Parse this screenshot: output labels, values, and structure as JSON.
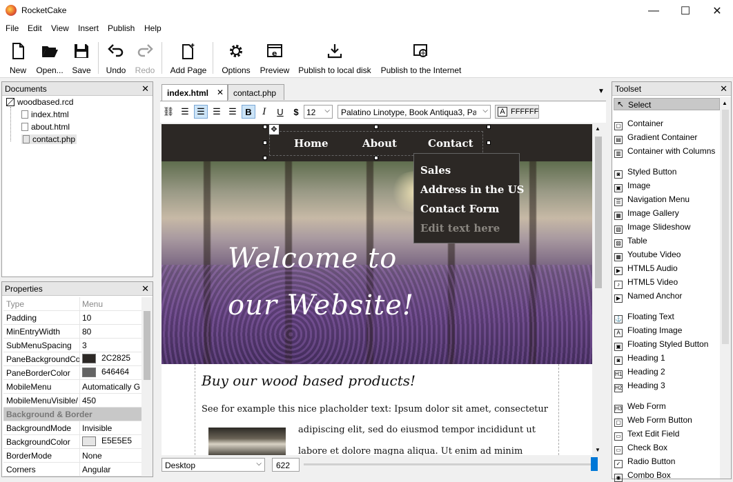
{
  "app": {
    "title": "RocketCake"
  },
  "window_controls": {
    "minimize": "—",
    "maximize": "☐",
    "close": "✕"
  },
  "menu": [
    "File",
    "Edit",
    "View",
    "Insert",
    "Publish",
    "Help"
  ],
  "toolbar": {
    "new": "New",
    "open": "Open...",
    "save": "Save",
    "undo": "Undo",
    "redo": "Redo",
    "add_page": "Add Page",
    "options": "Options",
    "preview": "Preview",
    "publish_local": "Publish to local disk",
    "publish_internet": "Publish to the Internet"
  },
  "documents": {
    "title": "Documents",
    "project": "woodbased.rcd",
    "files": [
      "index.html",
      "about.html",
      "contact.php"
    ],
    "selected": "contact.php"
  },
  "properties": {
    "title": "Properties",
    "header": {
      "name": "Type",
      "value": "Menu"
    },
    "rows": [
      {
        "name": "Padding",
        "value": "10"
      },
      {
        "name": "MinEntryWidth",
        "value": "80"
      },
      {
        "name": "SubMenuSpacing",
        "value": "3"
      },
      {
        "name": "PaneBackgroundCo",
        "value": "2C2825",
        "swatch": "#2c2825"
      },
      {
        "name": "PaneBorderColor",
        "value": "646464",
        "swatch": "#646464"
      },
      {
        "name": "MobileMenu",
        "value": "Automatically G"
      },
      {
        "name": "MobileMenuVisible/",
        "value": "450"
      }
    ],
    "section": "Background & Border",
    "rows2": [
      {
        "name": "BackgroundMode",
        "value": "Invisible"
      },
      {
        "name": "BackgroundColor",
        "value": "E5E5E5",
        "swatch": "#e5e5e5"
      },
      {
        "name": "BorderMode",
        "value": "None"
      },
      {
        "name": "Corners",
        "value": "Angular"
      }
    ]
  },
  "tabs": [
    {
      "label": "index.html",
      "active": true
    },
    {
      "label": "contact.php",
      "active": false
    }
  ],
  "format_bar": {
    "font_size": "12",
    "font_family": "Palatino Linotype, Book Antiqua3, Pal",
    "color_label": "A",
    "color_value": "FFFFFF"
  },
  "canvas": {
    "nav": [
      "Home",
      "About",
      "Contact"
    ],
    "dropdown": [
      "Sales",
      "Address in the US",
      "Contact Form",
      "Edit text here"
    ],
    "hero_line1": "Welcome to",
    "hero_line2": "our Website!",
    "heading": "Buy our wood based products!",
    "para1": "See for example this nice placholder text: Ipsum dolor sit amet, consectetur",
    "para2": "adipiscing elit, sed do eiusmod tempor incididunt ut",
    "para3": "labore et dolore magna aliqua. Ut enim ad minim"
  },
  "statusbar": {
    "view_mode": "Desktop",
    "width": "622"
  },
  "toolset": {
    "title": "Toolset",
    "select": "Select",
    "groups": [
      [
        "Container",
        "Gradient Container",
        "Container with Columns"
      ],
      [
        "Styled Button",
        "Image",
        "Navigation Menu",
        "Image Gallery",
        "Image Slideshow",
        "Table",
        "Youtube Video",
        "HTML5 Audio",
        "HTML5 Video",
        "Named Anchor"
      ],
      [
        "Floating Text",
        "Floating Image",
        "Floating Styled Button",
        "Heading 1",
        "Heading 2",
        "Heading 3"
      ],
      [
        "Web Form",
        "Web Form Button",
        "Text Edit Field",
        "Check Box",
        "Radio Button",
        "Combo Box"
      ]
    ]
  },
  "colors": {
    "accent": "#0078d7",
    "nav_bg": "#2c2825",
    "dropdown_border": "#646464"
  }
}
